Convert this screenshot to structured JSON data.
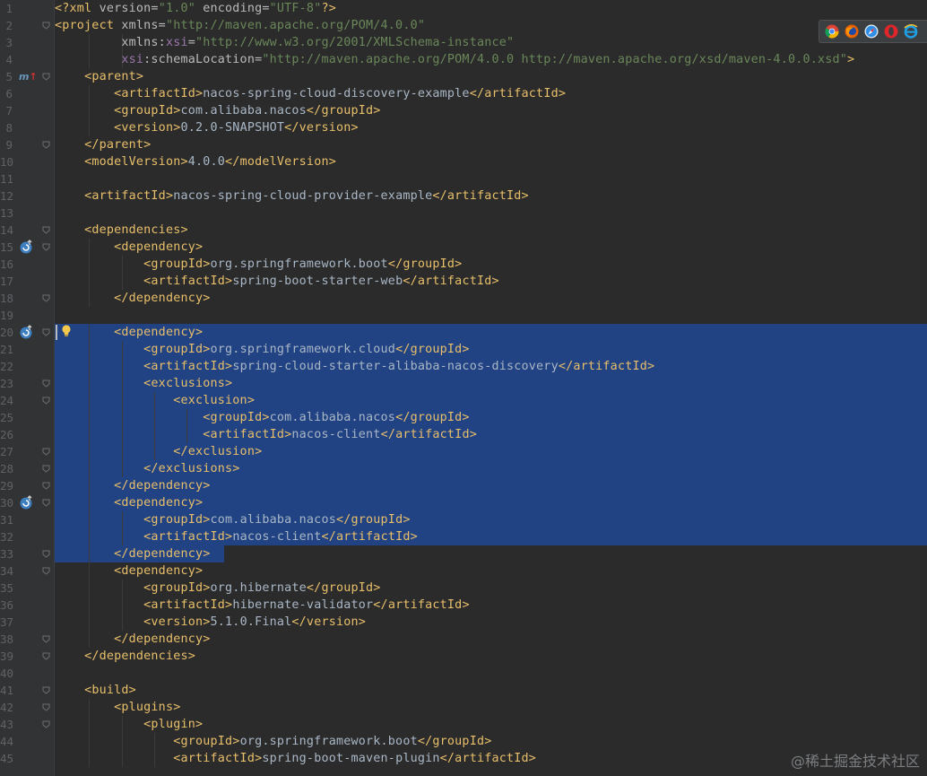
{
  "editor": {
    "file_type": "Maven POM (XML)",
    "lines": [
      {
        "n": "1",
        "code": [
          [
            "t",
            "<?xml "
          ],
          [
            "an",
            "version="
          ],
          [
            "av",
            "\"1.0\""
          ],
          [
            "an",
            " encoding="
          ],
          [
            "av",
            "\"UTF-8\""
          ],
          [
            "t",
            "?>"
          ]
        ]
      },
      {
        "n": "2",
        "code": [
          [
            "t",
            "<project "
          ],
          [
            "an",
            "xmlns="
          ],
          [
            "av",
            "\"http://maven.apache.org/POM/4.0.0\""
          ]
        ]
      },
      {
        "n": "3",
        "code": [
          [
            "tx",
            "         "
          ],
          [
            "an",
            "xmlns:"
          ],
          [
            "ns",
            "xsi"
          ],
          [
            "an",
            "="
          ],
          [
            "av",
            "\"http://www.w3.org/2001/XMLSchema-instance\""
          ]
        ]
      },
      {
        "n": "4",
        "code": [
          [
            "tx",
            "         "
          ],
          [
            "ns",
            "xsi"
          ],
          [
            "an",
            ":schemaLocation="
          ],
          [
            "av",
            "\"http://maven.apache.org/POM/4.0.0 http://maven.apache.org/xsd/maven-4.0.0.xsd\""
          ],
          [
            "t",
            ">"
          ]
        ]
      },
      {
        "n": "5",
        "code": [
          [
            "tx",
            "    "
          ],
          [
            "t",
            "<parent>"
          ]
        ]
      },
      {
        "n": "6",
        "code": [
          [
            "tx",
            "        "
          ],
          [
            "t",
            "<artifactId>"
          ],
          [
            "tx",
            "nacos-spring-cloud-discovery-example"
          ],
          [
            "t",
            "</artifactId>"
          ]
        ]
      },
      {
        "n": "7",
        "code": [
          [
            "tx",
            "        "
          ],
          [
            "t",
            "<groupId>"
          ],
          [
            "tx",
            "com.alibaba.nacos"
          ],
          [
            "t",
            "</groupId>"
          ]
        ]
      },
      {
        "n": "8",
        "code": [
          [
            "tx",
            "        "
          ],
          [
            "t",
            "<version>"
          ],
          [
            "tx",
            "0.2.0-SNAPSHOT"
          ],
          [
            "t",
            "</version>"
          ]
        ]
      },
      {
        "n": "9",
        "code": [
          [
            "tx",
            "    "
          ],
          [
            "t",
            "</parent>"
          ]
        ]
      },
      {
        "n": "10",
        "code": [
          [
            "tx",
            "    "
          ],
          [
            "t",
            "<modelVersion>"
          ],
          [
            "tx",
            "4.0.0"
          ],
          [
            "t",
            "</modelVersion>"
          ]
        ]
      },
      {
        "n": "11",
        "code": []
      },
      {
        "n": "12",
        "code": [
          [
            "tx",
            "    "
          ],
          [
            "t",
            "<artifactId>"
          ],
          [
            "tx",
            "nacos-spring-cloud-provider-example"
          ],
          [
            "t",
            "</artifactId>"
          ]
        ]
      },
      {
        "n": "13",
        "code": []
      },
      {
        "n": "14",
        "code": [
          [
            "tx",
            "    "
          ],
          [
            "t",
            "<dependencies>"
          ]
        ]
      },
      {
        "n": "15",
        "code": [
          [
            "tx",
            "        "
          ],
          [
            "t",
            "<dependency>"
          ]
        ]
      },
      {
        "n": "16",
        "code": [
          [
            "tx",
            "            "
          ],
          [
            "t",
            "<groupId>"
          ],
          [
            "tx",
            "org.springframework.boot"
          ],
          [
            "t",
            "</groupId>"
          ]
        ]
      },
      {
        "n": "17",
        "code": [
          [
            "tx",
            "            "
          ],
          [
            "t",
            "<artifactId>"
          ],
          [
            "tx",
            "spring-boot-starter-web"
          ],
          [
            "t",
            "</artifactId>"
          ]
        ]
      },
      {
        "n": "18",
        "code": [
          [
            "tx",
            "        "
          ],
          [
            "t",
            "</dependency>"
          ]
        ]
      },
      {
        "n": "19",
        "code": []
      },
      {
        "n": "20",
        "code": [
          [
            "tx",
            "        "
          ],
          [
            "t",
            "<dependency>"
          ]
        ]
      },
      {
        "n": "21",
        "code": [
          [
            "tx",
            "            "
          ],
          [
            "t",
            "<groupId>"
          ],
          [
            "tx",
            "org.springframework.cloud"
          ],
          [
            "t",
            "</groupId>"
          ]
        ]
      },
      {
        "n": "22",
        "code": [
          [
            "tx",
            "            "
          ],
          [
            "t",
            "<artifactId>"
          ],
          [
            "tx",
            "spring-cloud-starter-alibaba-nacos-discovery"
          ],
          [
            "t",
            "</artifactId>"
          ]
        ]
      },
      {
        "n": "23",
        "code": [
          [
            "tx",
            "            "
          ],
          [
            "t",
            "<exclusions>"
          ]
        ]
      },
      {
        "n": "24",
        "code": [
          [
            "tx",
            "                "
          ],
          [
            "t",
            "<exclusion>"
          ]
        ]
      },
      {
        "n": "25",
        "code": [
          [
            "tx",
            "                    "
          ],
          [
            "t",
            "<groupId>"
          ],
          [
            "tx",
            "com.alibaba.nacos"
          ],
          [
            "t",
            "</groupId>"
          ]
        ]
      },
      {
        "n": "26",
        "code": [
          [
            "tx",
            "                    "
          ],
          [
            "t",
            "<artifactId>"
          ],
          [
            "tx",
            "nacos-client"
          ],
          [
            "t",
            "</artifactId>"
          ]
        ]
      },
      {
        "n": "27",
        "code": [
          [
            "tx",
            "                "
          ],
          [
            "t",
            "</exclusion>"
          ]
        ]
      },
      {
        "n": "28",
        "code": [
          [
            "tx",
            "            "
          ],
          [
            "t",
            "</exclusions>"
          ]
        ]
      },
      {
        "n": "29",
        "code": [
          [
            "tx",
            "        "
          ],
          [
            "t",
            "</dependency>"
          ]
        ]
      },
      {
        "n": "30",
        "code": [
          [
            "tx",
            "        "
          ],
          [
            "t",
            "<dependency>"
          ]
        ]
      },
      {
        "n": "31",
        "code": [
          [
            "tx",
            "            "
          ],
          [
            "t",
            "<groupId>"
          ],
          [
            "tx",
            "com.alibaba.nacos"
          ],
          [
            "t",
            "</groupId>"
          ]
        ]
      },
      {
        "n": "32",
        "code": [
          [
            "tx",
            "            "
          ],
          [
            "t",
            "<artifactId>"
          ],
          [
            "tx",
            "nacos-client"
          ],
          [
            "t",
            "</artifactId>"
          ]
        ]
      },
      {
        "n": "33",
        "code": [
          [
            "tx",
            "        "
          ],
          [
            "t",
            "</dependency>"
          ]
        ]
      },
      {
        "n": "34",
        "code": [
          [
            "tx",
            "        "
          ],
          [
            "t",
            "<dependency>"
          ]
        ]
      },
      {
        "n": "35",
        "code": [
          [
            "tx",
            "            "
          ],
          [
            "t",
            "<groupId>"
          ],
          [
            "tx",
            "org.hibernate"
          ],
          [
            "t",
            "</groupId>"
          ]
        ]
      },
      {
        "n": "36",
        "code": [
          [
            "tx",
            "            "
          ],
          [
            "t",
            "<artifactId>"
          ],
          [
            "tx",
            "hibernate-validator"
          ],
          [
            "t",
            "</artifactId>"
          ]
        ]
      },
      {
        "n": "37",
        "code": [
          [
            "tx",
            "            "
          ],
          [
            "t",
            "<version>"
          ],
          [
            "tx",
            "5.1.0.Final"
          ],
          [
            "t",
            "</version>"
          ]
        ]
      },
      {
        "n": "38",
        "code": [
          [
            "tx",
            "        "
          ],
          [
            "t",
            "</dependency>"
          ]
        ]
      },
      {
        "n": "39",
        "code": [
          [
            "tx",
            "    "
          ],
          [
            "t",
            "</dependencies>"
          ]
        ]
      },
      {
        "n": "40",
        "code": []
      },
      {
        "n": "41",
        "code": [
          [
            "tx",
            "    "
          ],
          [
            "t",
            "<build>"
          ]
        ]
      },
      {
        "n": "42",
        "code": [
          [
            "tx",
            "        "
          ],
          [
            "t",
            "<plugins>"
          ]
        ]
      },
      {
        "n": "43",
        "code": [
          [
            "tx",
            "            "
          ],
          [
            "t",
            "<plugin>"
          ]
        ]
      },
      {
        "n": "44",
        "code": [
          [
            "tx",
            "                "
          ],
          [
            "t",
            "<groupId>"
          ],
          [
            "tx",
            "org.springframework.boot"
          ],
          [
            "t",
            "</groupId>"
          ]
        ]
      },
      {
        "n": "45",
        "code": [
          [
            "tx",
            "                "
          ],
          [
            "t",
            "<artifactId>"
          ],
          [
            "tx",
            "spring-boot-maven-plugin"
          ],
          [
            "t",
            "</artifactId>"
          ]
        ]
      }
    ],
    "fold_lines": [
      "2",
      "5",
      "9",
      "14",
      "15",
      "18",
      "20",
      "23",
      "24",
      "27",
      "28",
      "29",
      "30",
      "33",
      "34",
      "38",
      "39",
      "41",
      "42",
      "43"
    ],
    "maven_marker_line": "5",
    "maven_marker_text": "m",
    "dependency_marker_lines": [
      "15",
      "20",
      "30"
    ],
    "caret_line": "20",
    "intention_bulb_line": "20",
    "selection": {
      "start_line": "20",
      "end_line": "33",
      "end_text": "</dependency>"
    }
  },
  "browser_bar": {
    "icons": [
      "chrome-icon",
      "firefox-icon",
      "safari-icon",
      "opera-icon",
      "ie-icon"
    ]
  },
  "watermark": "@稀土掘金技术社区",
  "colors": {
    "background": "#2b2b2b",
    "gutter": "#313335",
    "selection": "#214283",
    "tag": "#e8bf6a",
    "attribute_name": "#bababa",
    "attribute_value": "#6a8759",
    "namespace": "#9876aa",
    "text": "#a9b7c6",
    "line_number": "#606366"
  }
}
